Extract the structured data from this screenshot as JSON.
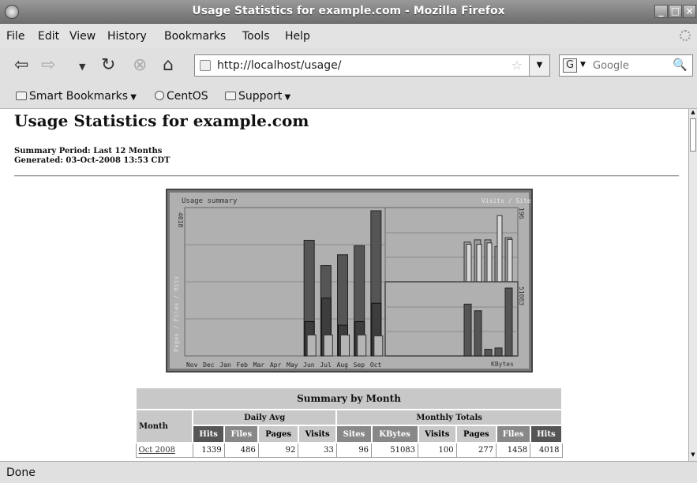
{
  "window": {
    "title": "Usage Statistics for example.com - Mozilla Firefox"
  },
  "menu": [
    "File",
    "Edit",
    "View",
    "History",
    "Bookmarks",
    "Tools",
    "Help"
  ],
  "nav": {
    "url": "http://localhost/usage/",
    "search_placeholder": "Google"
  },
  "bookmarks": [
    {
      "label": "Smart Bookmarks",
      "icon": "folder-icon",
      "dropdown": true
    },
    {
      "label": "CentOS",
      "icon": "page-icon",
      "dropdown": false
    },
    {
      "label": "Support",
      "icon": "folder-icon",
      "dropdown": true
    }
  ],
  "page": {
    "heading": "Usage Statistics for example.com",
    "summary_period": "Summary Period: Last 12 Months",
    "generated": "Generated: 03-Oct-2008 13:53 CDT"
  },
  "chart_data": {
    "type": "bar",
    "title": "Usage summary",
    "legend_right": "Visits / Sites",
    "left_axis_label": "Pages / Files / Hits",
    "right_bottom_label": "KBytes",
    "left_max_label": "4018",
    "right_top_max_label": "196",
    "right_bottom_max_label": "51083",
    "categories": [
      "Nov",
      "Dec",
      "Jan",
      "Feb",
      "Mar",
      "Apr",
      "May",
      "Jun",
      "Jul",
      "Aug",
      "Sep",
      "Oct"
    ],
    "series": [
      {
        "name": "Hits",
        "values": [
          0,
          0,
          0,
          0,
          0,
          0,
          0,
          3200,
          2500,
          2800,
          3050,
          4018
        ]
      },
      {
        "name": "Files",
        "values": [
          0,
          0,
          0,
          0,
          0,
          0,
          0,
          950,
          1600,
          850,
          950,
          1458
        ]
      },
      {
        "name": "Pages",
        "values": [
          0,
          0,
          0,
          0,
          0,
          0,
          0,
          290,
          290,
          290,
          290,
          277
        ]
      },
      {
        "name": "Visits",
        "values": [
          0,
          0,
          0,
          0,
          0,
          0,
          0,
          90,
          95,
          95,
          80,
          100
        ]
      },
      {
        "name": "Sites",
        "values": [
          0,
          0,
          0,
          0,
          0,
          0,
          0,
          85,
          85,
          88,
          150,
          96
        ]
      },
      {
        "name": "KBytes",
        "values": [
          0,
          0,
          0,
          0,
          0,
          0,
          0,
          39000,
          34000,
          5000,
          6000,
          51083
        ]
      }
    ],
    "colors": {
      "hits": "#555555",
      "files": "#3d3d3d",
      "pages": "#b5b5b5",
      "visits": "#9a9a9a",
      "sites": "#d8d8d8",
      "kbytes": "#555555",
      "bg": "#b0b0b0"
    }
  },
  "summary": {
    "caption": "Summary by Month",
    "month_header": "Month",
    "group_daily": "Daily Avg",
    "group_monthly": "Monthly Totals",
    "daily_cols": [
      "Hits",
      "Files",
      "Pages",
      "Visits"
    ],
    "monthly_cols": [
      "Sites",
      "KBytes",
      "Visits",
      "Pages",
      "Files",
      "Hits"
    ],
    "rows": [
      {
        "month": "Oct 2008",
        "cells": [
          "1339",
          "486",
          "92",
          "33",
          "96",
          "51083",
          "100",
          "277",
          "1458",
          "4018"
        ]
      }
    ]
  },
  "status": {
    "text": "Done"
  }
}
